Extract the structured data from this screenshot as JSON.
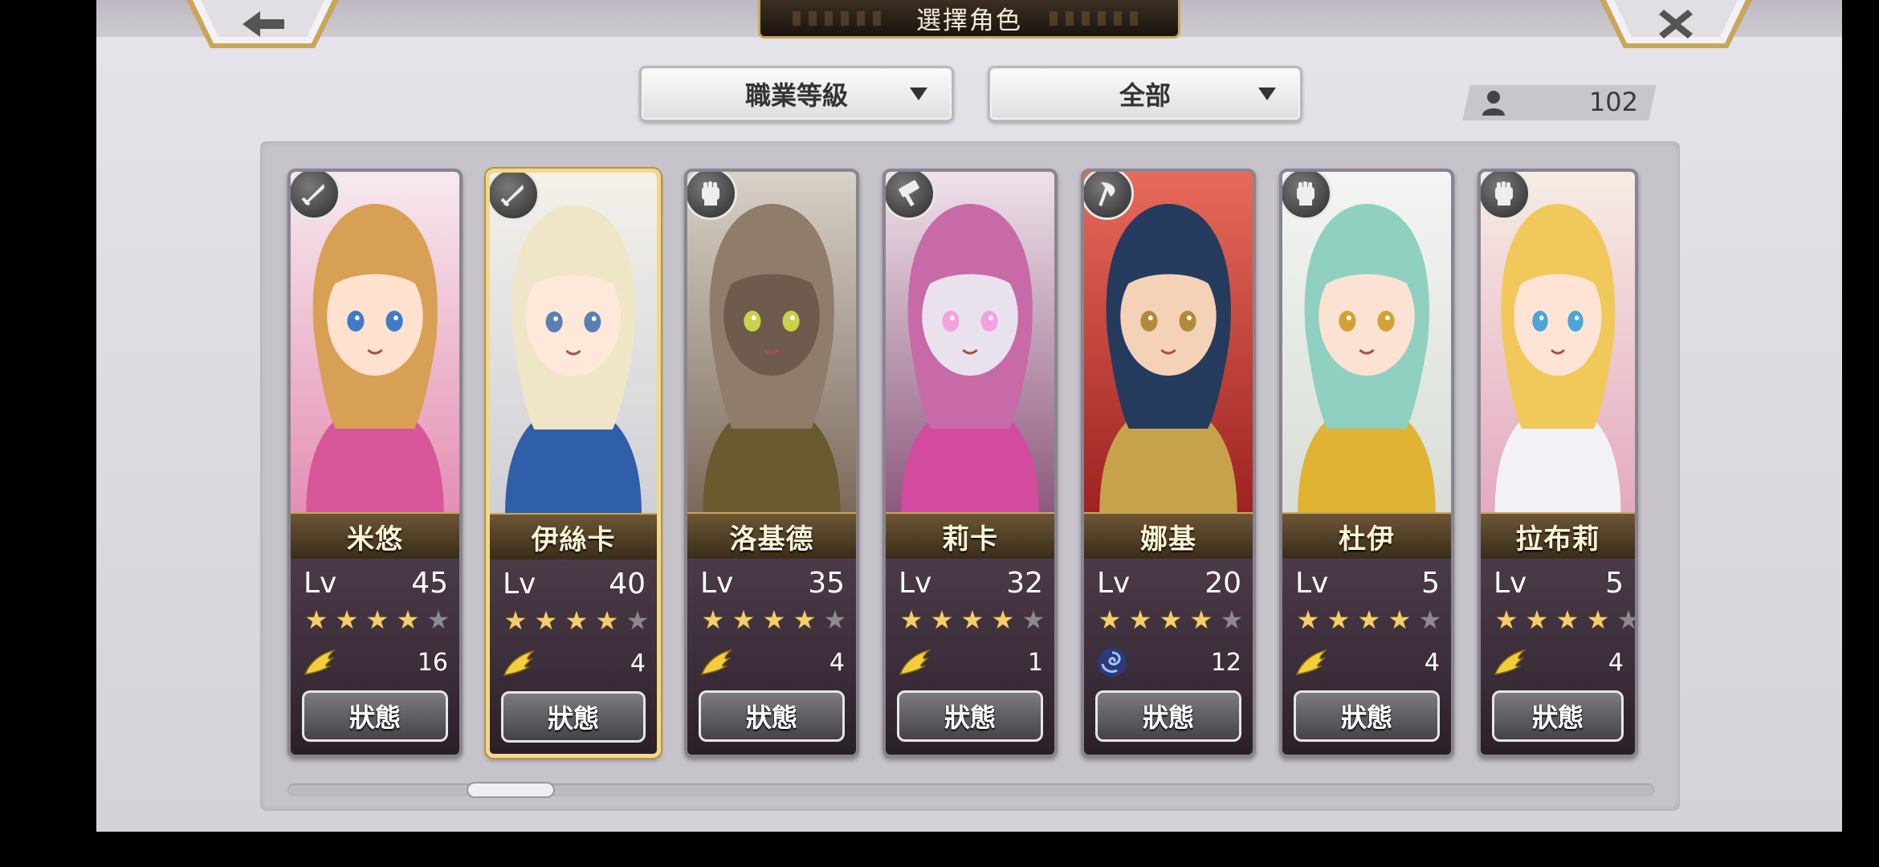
{
  "header": {
    "title": "選擇角色",
    "back_icon": "arrow-left-icon",
    "close_icon": "close-icon"
  },
  "filters": {
    "class_sort": "職業等級",
    "category": "全部"
  },
  "roster": {
    "count": "102",
    "icon": "person-icon"
  },
  "colors": {
    "card_border_selected": "#f1d98b",
    "star_on": "#f2cf6b",
    "star_off": "#8d8a8f"
  },
  "characters": [
    {
      "name": "米悠",
      "lv_label": "Lv",
      "level": "45",
      "stars": 4,
      "max_stars": 5,
      "skill_icon": "wing-icon",
      "skill_count": "16",
      "status_label": "狀態",
      "class_icon": "sword-icon",
      "selected": false
    },
    {
      "name": "伊絲卡",
      "lv_label": "Lv",
      "level": "40",
      "stars": 4,
      "max_stars": 5,
      "skill_icon": "wing-icon",
      "skill_count": "4",
      "status_label": "狀態",
      "class_icon": "sword-icon",
      "selected": true
    },
    {
      "name": "洛基德",
      "lv_label": "Lv",
      "level": "35",
      "stars": 4,
      "max_stars": 5,
      "skill_icon": "wing-icon",
      "skill_count": "4",
      "status_label": "狀態",
      "class_icon": "fist-icon",
      "selected": false
    },
    {
      "name": "莉卡",
      "lv_label": "Lv",
      "level": "32",
      "stars": 4,
      "max_stars": 5,
      "skill_icon": "wing-icon",
      "skill_count": "1",
      "status_label": "狀態",
      "class_icon": "hammer-icon",
      "selected": false
    },
    {
      "name": "娜基",
      "lv_label": "Lv",
      "level": "20",
      "stars": 4,
      "max_stars": 5,
      "skill_icon": "swirl-icon",
      "skill_count": "12",
      "status_label": "狀態",
      "class_icon": "axe-icon",
      "selected": false
    },
    {
      "name": "杜伊",
      "lv_label": "Lv",
      "level": "5",
      "stars": 4,
      "max_stars": 5,
      "skill_icon": "wing-icon",
      "skill_count": "4",
      "status_label": "狀態",
      "class_icon": "fist-icon",
      "selected": false
    },
    {
      "name": "拉布莉",
      "lv_label": "Lv",
      "level": "5",
      "stars": 4,
      "max_stars": 5,
      "skill_icon": "wing-icon",
      "skill_count": "4",
      "status_label": "狀態",
      "class_icon": "fist-icon",
      "selected": false
    }
  ],
  "scroll": {
    "position": 0.14
  }
}
